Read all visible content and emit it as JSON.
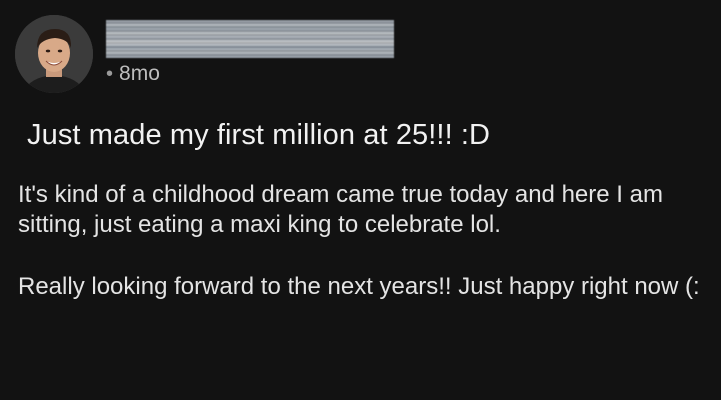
{
  "post": {
    "avatar_alt": "user-avatar",
    "timestamp": "8mo",
    "separator": "•",
    "title": "Just made my first million at 25!!! :D",
    "paragraphs": [
      "It's kind of a childhood dream came true today and here I am sitting, just eating a maxi king to celebrate lol.",
      "Really looking forward to the next years!! Just happy right now (:"
    ]
  },
  "colors": {
    "background": "#121212",
    "text": "#e4e4e4",
    "muted": "#bdbdbd"
  }
}
